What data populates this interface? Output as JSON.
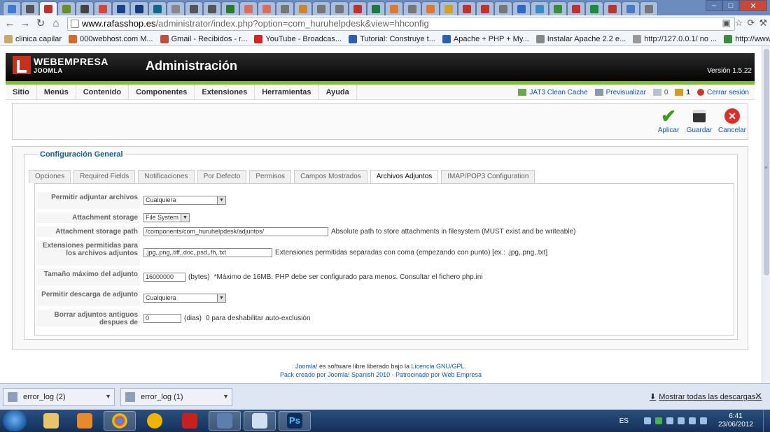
{
  "browser": {
    "tab_count": 36,
    "url_domain": "www.rafasshop.es",
    "url_path": "/administrator/index.php?option=com_huruhelpdesk&view=hhconfig",
    "bookmarks": [
      {
        "label": "clinica capilar",
        "color": "#c8a96b"
      },
      {
        "label": "000webhost.com M...",
        "color": "#d36b2c"
      },
      {
        "label": "Gmail - Recibidos - r...",
        "color": "#c84a3b"
      },
      {
        "label": "YouTube - Broadcas...",
        "color": "#d62222"
      },
      {
        "label": "Tutorial: Construye t...",
        "color": "#2b5fb4"
      },
      {
        "label": "Apache + PHP + My...",
        "color": "#2b5fb4"
      },
      {
        "label": "Instalar Apache 2.2 e...",
        "color": "#888888"
      },
      {
        "label": "http://127.0.0.1/ no ...",
        "color": "#999999"
      },
      {
        "label": "http://www.google...",
        "color": "#3a8c3a"
      }
    ]
  },
  "joomla": {
    "brand": "WEBEMPRESA",
    "brand_sub": "JOOMLA",
    "title": "Administración",
    "version": "Versión 1.5.22",
    "accent_green": "#7bbf2a",
    "menu": [
      "Sitio",
      "Menús",
      "Contenido",
      "Componentes",
      "Extensiones",
      "Herramientas",
      "Ayuda"
    ],
    "menu_right": {
      "cache": "JAT3 Clean Cache",
      "preview": "Previsualizar",
      "messages": "0",
      "users": "1",
      "logout": "Cerrar sesión"
    },
    "toolbar": {
      "apply": "Aplicar",
      "save": "Guardar",
      "cancel": "Cancelar"
    },
    "config": {
      "legend": "Configuración General",
      "tabs": [
        "Opciones",
        "Required Fields",
        "Notificaciones",
        "Por Defecto",
        "Permisos",
        "Campos Mostrados",
        "Archivos Adjuntos",
        "IMAP/POP3 Configuration"
      ],
      "active_tab": "Archivos Adjuntos",
      "fields": {
        "allow_attach_label": "Permitir adjuntar archivos",
        "allow_attach_value": "Cualquiera",
        "storage_label": "Attachment storage",
        "storage_value": "File System",
        "path_label": "Attachment storage path",
        "path_value": "/components/com_huruhelpdesk/adjuntos/",
        "path_help": "Absolute path to store attachments in filesystem (MUST exist and be writeable)",
        "ext_label": "Extensiones permitidas para los archivos adjuntos",
        "ext_value": ".jpg,.png,.tiff,.doc,.psd,.fh,.txt",
        "ext_help": "Extensiones permitidas separadas con coma (empezando con punto) [ex.: .jpg,.png,.txt]",
        "maxsize_label": "Tamaño máximo del adjunto",
        "maxsize_value": "16000000",
        "maxsize_unit": "(bytes)",
        "maxsize_help": "*Máximo de 16MB. PHP debe ser configurado para menos. Consultar el fichero php.ini",
        "download_label": "Permitir descarga de adjunto",
        "download_value": "Cualquiera",
        "delete_label": "Borrar adjuntos antiguos despues de",
        "delete_value": "0",
        "delete_unit": "(dias)",
        "delete_help": "0 para deshabilitar auto-exclusión"
      }
    },
    "footer": {
      "line1_link": "Joomla!",
      "line1_text": " es software libre liberado bajo la ",
      "line1_license": "Licencia GNU/GPL.",
      "line2": "Pack creado por Joomla! Spanish 2010 - Patrocinado por Web Empresa"
    }
  },
  "downloads": {
    "items": [
      "error_log (2)",
      "error_log (1)"
    ],
    "show_all": "Mostrar todas las descargas..."
  },
  "taskbar": {
    "lang": "ES",
    "time": "6:41",
    "date": "23/06/2012"
  }
}
